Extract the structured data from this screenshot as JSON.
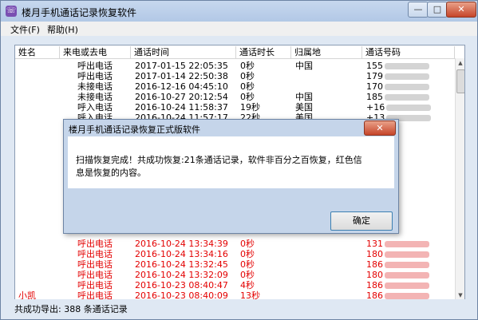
{
  "window": {
    "title": "楼月手机通话记录恢复软件",
    "icon": "phone-app-icon",
    "controls": {
      "minimize": "—",
      "maximize": "□",
      "close": "✕"
    }
  },
  "menu": {
    "items": [
      "文件(F)",
      "帮助(H)"
    ]
  },
  "table": {
    "columns": [
      "姓名",
      "来电或去电",
      "通话时间",
      "通话时长",
      "归属地",
      "通话号码"
    ],
    "rows": [
      {
        "name": "",
        "type": "呼出电话",
        "time": "2017-01-15 22:05:35",
        "duration": "0秒",
        "location": "中国",
        "number": "155",
        "red": false
      },
      {
        "name": "",
        "type": "呼出电话",
        "time": "2017-01-14 22:50:38",
        "duration": "0秒",
        "location": "",
        "number": "179",
        "red": false
      },
      {
        "name": "",
        "type": "未接电话",
        "time": "2016-12-16 04:45:10",
        "duration": "0秒",
        "location": "",
        "number": "170",
        "red": false
      },
      {
        "name": "",
        "type": "未接电话",
        "time": "2016-10-27 20:12:54",
        "duration": "0秒",
        "location": "中国",
        "number": "185",
        "red": false
      },
      {
        "name": "",
        "type": "呼入电话",
        "time": "2016-10-24 11:58:37",
        "duration": "19秒",
        "location": "美国",
        "number": "+16",
        "red": false
      },
      {
        "name": "",
        "type": "呼入电话",
        "time": "2016-10-24 11:57:17",
        "duration": "22秒",
        "location": "美国",
        "number": "+13",
        "red": false
      },
      {
        "name": "",
        "type": "呼出电话",
        "time": "2016-10-24 13:34:39",
        "duration": "0秒",
        "location": "",
        "number": "131",
        "red": true
      },
      {
        "name": "",
        "type": "呼出电话",
        "time": "2016-10-24 13:34:16",
        "duration": "0秒",
        "location": "",
        "number": "180",
        "red": true
      },
      {
        "name": "",
        "type": "呼出电话",
        "time": "2016-10-24 13:32:45",
        "duration": "0秒",
        "location": "",
        "number": "186",
        "red": true
      },
      {
        "name": "",
        "type": "呼出电话",
        "time": "2016-10-24 13:32:09",
        "duration": "0秒",
        "location": "",
        "number": "180",
        "red": true
      },
      {
        "name": "",
        "type": "呼出电话",
        "time": "2016-10-23 08:40:47",
        "duration": "4秒",
        "location": "",
        "number": "186",
        "red": true
      },
      {
        "name": "小凯",
        "type": "呼出电话",
        "time": "2016-10-23 08:40:09",
        "duration": "13秒",
        "location": "",
        "number": "186",
        "red": true
      }
    ]
  },
  "status": {
    "text": "共成功导出: 388 条通话记录"
  },
  "dialog": {
    "title": "楼月手机通话记录恢复正式版软件",
    "close": "✕",
    "message": "扫描恢复完成！共成功恢复:21条通话记录，软件非百分之百恢复，红色信息是恢复的内容。",
    "ok_label": "确定"
  }
}
